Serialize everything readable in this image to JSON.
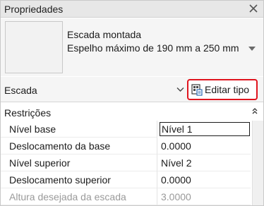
{
  "panel": {
    "title": "Propriedades",
    "close_icon": "close-icon"
  },
  "type_selector": {
    "family": "Escada montada",
    "type_name": "Espelho máximo de 190 mm a 250 mm",
    "dropdown_icon": "chevron-down-icon"
  },
  "instance_selector": {
    "category": "Escada",
    "dropdown_icon": "chevron-down-icon",
    "edit_type_label": "Editar tipo",
    "edit_type_icon": "edit-type-icon",
    "highlight_color": "#e0141e"
  },
  "section": {
    "label": "Restrições",
    "collapse_icon": "collapse-icon"
  },
  "parameters": [
    {
      "name": "Nível base",
      "value": "Nível 1",
      "editing": true,
      "enabled": true
    },
    {
      "name": "Deslocamento da base",
      "value": "0.0000",
      "editing": false,
      "enabled": true
    },
    {
      "name": "Nível superior",
      "value": "Nível 2",
      "editing": false,
      "enabled": true
    },
    {
      "name": "Deslocamento superior",
      "value": "0.0000",
      "editing": false,
      "enabled": true
    },
    {
      "name": "Altura desejada da escada",
      "value": "3.0000",
      "editing": false,
      "enabled": false
    }
  ]
}
